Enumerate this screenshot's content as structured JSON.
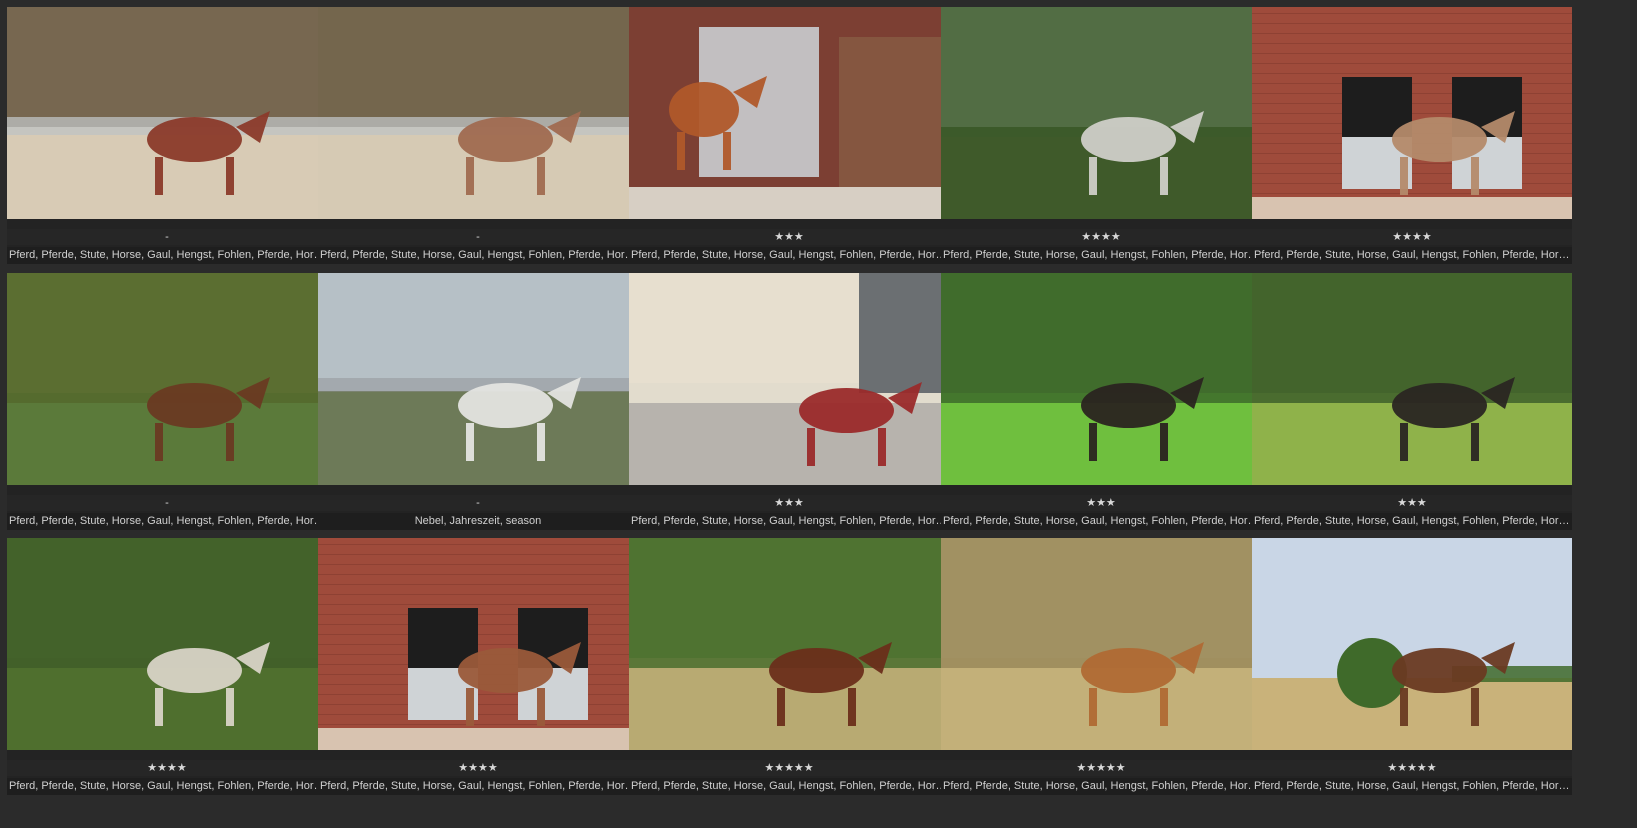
{
  "photos": [
    {
      "id": "p1",
      "rating": "-",
      "keywords": "Pferd, Pferde, Stute, Horse, Gaul, Hengst, Fohlen, Pferde, Horse",
      "scene": "arena",
      "palette": {
        "sky": "#8a7a62",
        "ground": "#d8cbb5",
        "tree": "#6b5a45",
        "horse": "#8b3a2a"
      }
    },
    {
      "id": "p2",
      "rating": "-",
      "keywords": "Pferd, Pferde, Stute, Horse, Gaul, Hengst, Fohlen, Pferde, Horse",
      "scene": "arena",
      "palette": {
        "sky": "#82765c",
        "ground": "#d6cab4",
        "tree": "#6a5b43",
        "horse": "#a06a50"
      }
    },
    {
      "id": "p3",
      "rating": "★★★",
      "keywords": "Pferd, Pferde, Stute, Horse, Gaul, Hengst, Fohlen, Pferde, Horse",
      "scene": "stable",
      "palette": {
        "sky": "#8a4a38",
        "ground": "#d7cfc4",
        "tree": "#9a5a45",
        "horse": "#b0582a"
      }
    },
    {
      "id": "p4",
      "rating": "★★★★",
      "keywords": "Pferd, Pferde, Stute, Horse, Gaul, Hengst, Fohlen, Pferde, Horse",
      "scene": "field",
      "palette": {
        "sky": "#cfd3d4",
        "ground": "#3f5a2a",
        "tree": "#3c5a2a",
        "horse": "#cfcfc8"
      }
    },
    {
      "id": "p5",
      "rating": "★★★★",
      "keywords": "Pferd, Pferde, Stute, Horse, Gaul, Hengst, Fohlen, Pferde, Horse",
      "scene": "brick",
      "palette": {
        "sky": "#a5503f",
        "ground": "#d8c3b0",
        "tree": "#8d4433",
        "horse": "#b48a6a"
      }
    },
    {
      "id": "p6",
      "rating": "-",
      "keywords": "Pferd, Pferde, Stute, Horse, Gaul, Hengst, Fohlen, Pferde, Horse",
      "scene": "meadow",
      "palette": {
        "sky": "#7d8a4a",
        "ground": "#5b7a3a",
        "tree": "#55692d",
        "horse": "#6a3a22"
      }
    },
    {
      "id": "p7",
      "rating": "-",
      "keywords": "Nebel, Jahreszeit, season",
      "scene": "fog",
      "palette": {
        "sky": "#b6c0c6",
        "ground": "#6d7a58",
        "tree": "#8c959a",
        "horse": "#e4e4e0"
      }
    },
    {
      "id": "p8",
      "rating": "★★★",
      "keywords": "Pferd, Pferde, Stute, Horse, Gaul, Hengst, Fohlen, Pferde, Horse",
      "scene": "city",
      "palette": {
        "sky": "#e2dccd",
        "ground": "#b7b3ad",
        "tree": "#6b6f72",
        "horse": "#9a2a2a"
      }
    },
    {
      "id": "p9",
      "rating": "★★★",
      "keywords": "Pferd, Pferde, Stute, Horse, Gaul, Hengst, Fohlen, Pferde, Horse",
      "scene": "meadow",
      "palette": {
        "sky": "#4f7a3a",
        "ground": "#6fbf3e",
        "tree": "#3d6a2a",
        "horse": "#2a2420"
      }
    },
    {
      "id": "p10",
      "rating": "★★★",
      "keywords": "Pferd, Pferde, Stute, Horse, Gaul, Hengst, Fohlen, Pferde, Horse",
      "scene": "meadow",
      "palette": {
        "sky": "#5f7f3a",
        "ground": "#8fb24a",
        "tree": "#3e5f2a",
        "horse": "#2a2622"
      }
    },
    {
      "id": "p11",
      "rating": "★★★★",
      "keywords": "Pferd, Pferde, Stute, Horse, Gaul, Hengst, Fohlen, Pferde, Horse",
      "scene": "meadow",
      "palette": {
        "sky": "#5b7a38",
        "ground": "#4f6f2e",
        "tree": "#3f5e28",
        "horse": "#d8d3c6"
      }
    },
    {
      "id": "p12",
      "rating": "★★★★",
      "keywords": "Pferd, Pferde, Stute, Horse, Gaul, Hengst, Fohlen, Pferde, Horse",
      "scene": "brick",
      "palette": {
        "sky": "#a34d3c",
        "ground": "#d8c3b0",
        "tree": "#8a4333",
        "horse": "#9a5a3a"
      }
    },
    {
      "id": "p13",
      "rating": "★★★★★",
      "keywords": "Pferd, Pferde, Stute, Horse, Gaul, Hengst, Fohlen, Pferde, Horse",
      "scene": "pasture",
      "palette": {
        "sky": "#6a8a45",
        "ground": "#b8aa72",
        "tree": "#4a6f2e",
        "horse": "#6a2e1a"
      }
    },
    {
      "id": "p14",
      "rating": "★★★★★",
      "keywords": "Pferd, Pferde, Stute, Horse, Gaul, Hengst, Fohlen, Pferde, Horse",
      "scene": "pasture",
      "palette": {
        "sky": "#c8b98a",
        "ground": "#c3b079",
        "tree": "#9a8a5a",
        "horse": "#b06a34"
      }
    },
    {
      "id": "p15",
      "rating": "★★★★★",
      "keywords": "Pferd, Pferde, Stute, Horse, Gaul, Hengst, Fohlen, Pferde, Horse",
      "scene": "open",
      "palette": {
        "sky": "#c9d6e6",
        "ground": "#c9b27a",
        "tree": "#3f6a2a",
        "horse": "#6a3a22"
      }
    }
  ]
}
